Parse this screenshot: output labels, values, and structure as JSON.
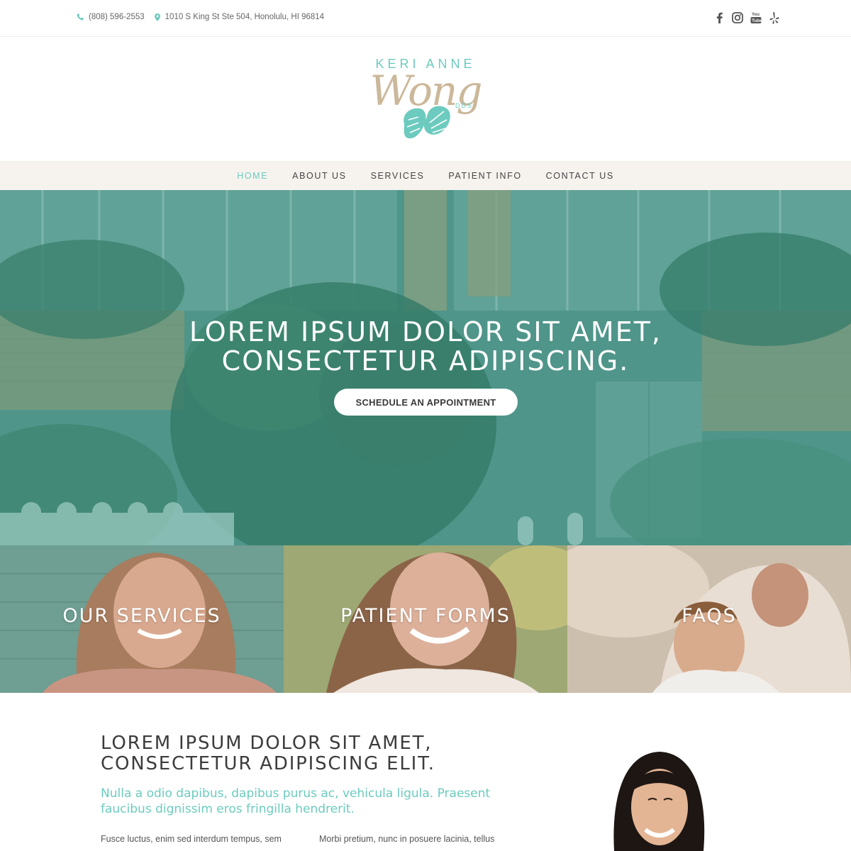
{
  "topbar": {
    "phone": "(808) 596-2553",
    "address": "1010 S King St Ste 504, Honolulu, HI 96814",
    "social": [
      "facebook-icon",
      "instagram-icon",
      "youtube-icon",
      "yelp-icon"
    ]
  },
  "logo": {
    "line1": "KERI ANNE",
    "line2": "Wong",
    "suffix": "DDS"
  },
  "nav": {
    "items": [
      {
        "label": "HOME",
        "active": true
      },
      {
        "label": "ABOUT US",
        "active": false
      },
      {
        "label": "SERVICES",
        "active": false
      },
      {
        "label": "PATIENT INFO",
        "active": false
      },
      {
        "label": "CONTACT US",
        "active": false
      }
    ]
  },
  "hero": {
    "title_line1": "LOREM IPSUM DOLOR SIT AMET,",
    "title_line2": "CONSECTETUR ADIPISCING.",
    "cta": "SCHEDULE AN APPOINTMENT"
  },
  "tiles": [
    {
      "label": "OUR SERVICES"
    },
    {
      "label": "PATIENT FORMS"
    },
    {
      "label": "FAQS"
    }
  ],
  "intro": {
    "heading_line1": "LOREM IPSUM DOLOR SIT AMET,",
    "heading_line2": "CONSECTETUR ADIPISCING ELIT.",
    "sub": "Nulla a odio dapibus, dapibus purus ac, vehicula ligula. Praesent faucibus dignissim eros fringilla hendrerit.",
    "col1": "Fusce luctus, enim sed interdum tempus, sem",
    "col2": "Morbi pretium, nunc in posuere lacinia, tellus"
  },
  "colors": {
    "accent": "#6ccbbe",
    "logo_tan": "#cbb89a",
    "nav_bg": "#f6f3ef",
    "hero_tint": "#40968a"
  }
}
